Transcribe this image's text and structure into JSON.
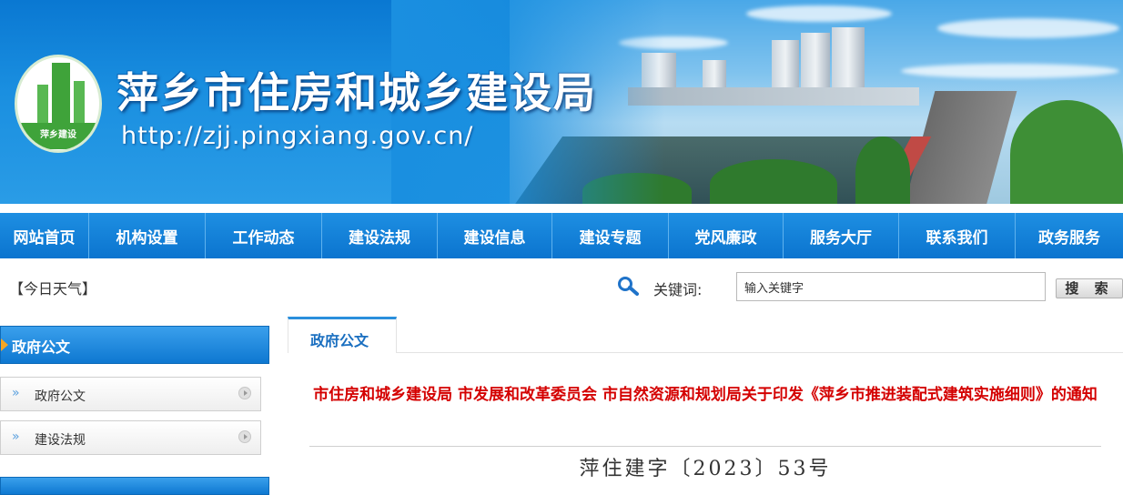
{
  "banner": {
    "title": "萍乡市住房和城乡建设局",
    "url": "http://zjj.pingxiang.gov.cn/",
    "logo_text": "萍乡建设"
  },
  "nav": {
    "items": [
      {
        "label": "网站首页"
      },
      {
        "label": "机构设置"
      },
      {
        "label": "工作动态"
      },
      {
        "label": "建设法规"
      },
      {
        "label": "建设信息"
      },
      {
        "label": "建设专题"
      },
      {
        "label": "党风廉政"
      },
      {
        "label": "服务大厅"
      },
      {
        "label": "联系我们"
      },
      {
        "label": "政务服务"
      }
    ]
  },
  "toolbar": {
    "weather": "【今日天气】",
    "keyword_label": "关键词:",
    "search_value": "输入关键字",
    "search_button": "搜 索",
    "search_icon": "magnifier-icon"
  },
  "sidebar": {
    "heading": "政府公文",
    "items": [
      {
        "label": "政府公文",
        "chevron": "»"
      },
      {
        "label": "建设法规",
        "chevron": "»"
      }
    ]
  },
  "main": {
    "tab": "政府公文",
    "document": {
      "title": "市住房和城乡建设局 市发展和改革委员会 市自然资源和规划局关于印发《萍乡市推进装配式建筑实施细则》的通知",
      "number": "萍住建字〔2023〕53号"
    }
  },
  "colors": {
    "nav_blue": "#0b74cf",
    "title_red": "#d40000",
    "tab_text": "#1a6fc0"
  }
}
